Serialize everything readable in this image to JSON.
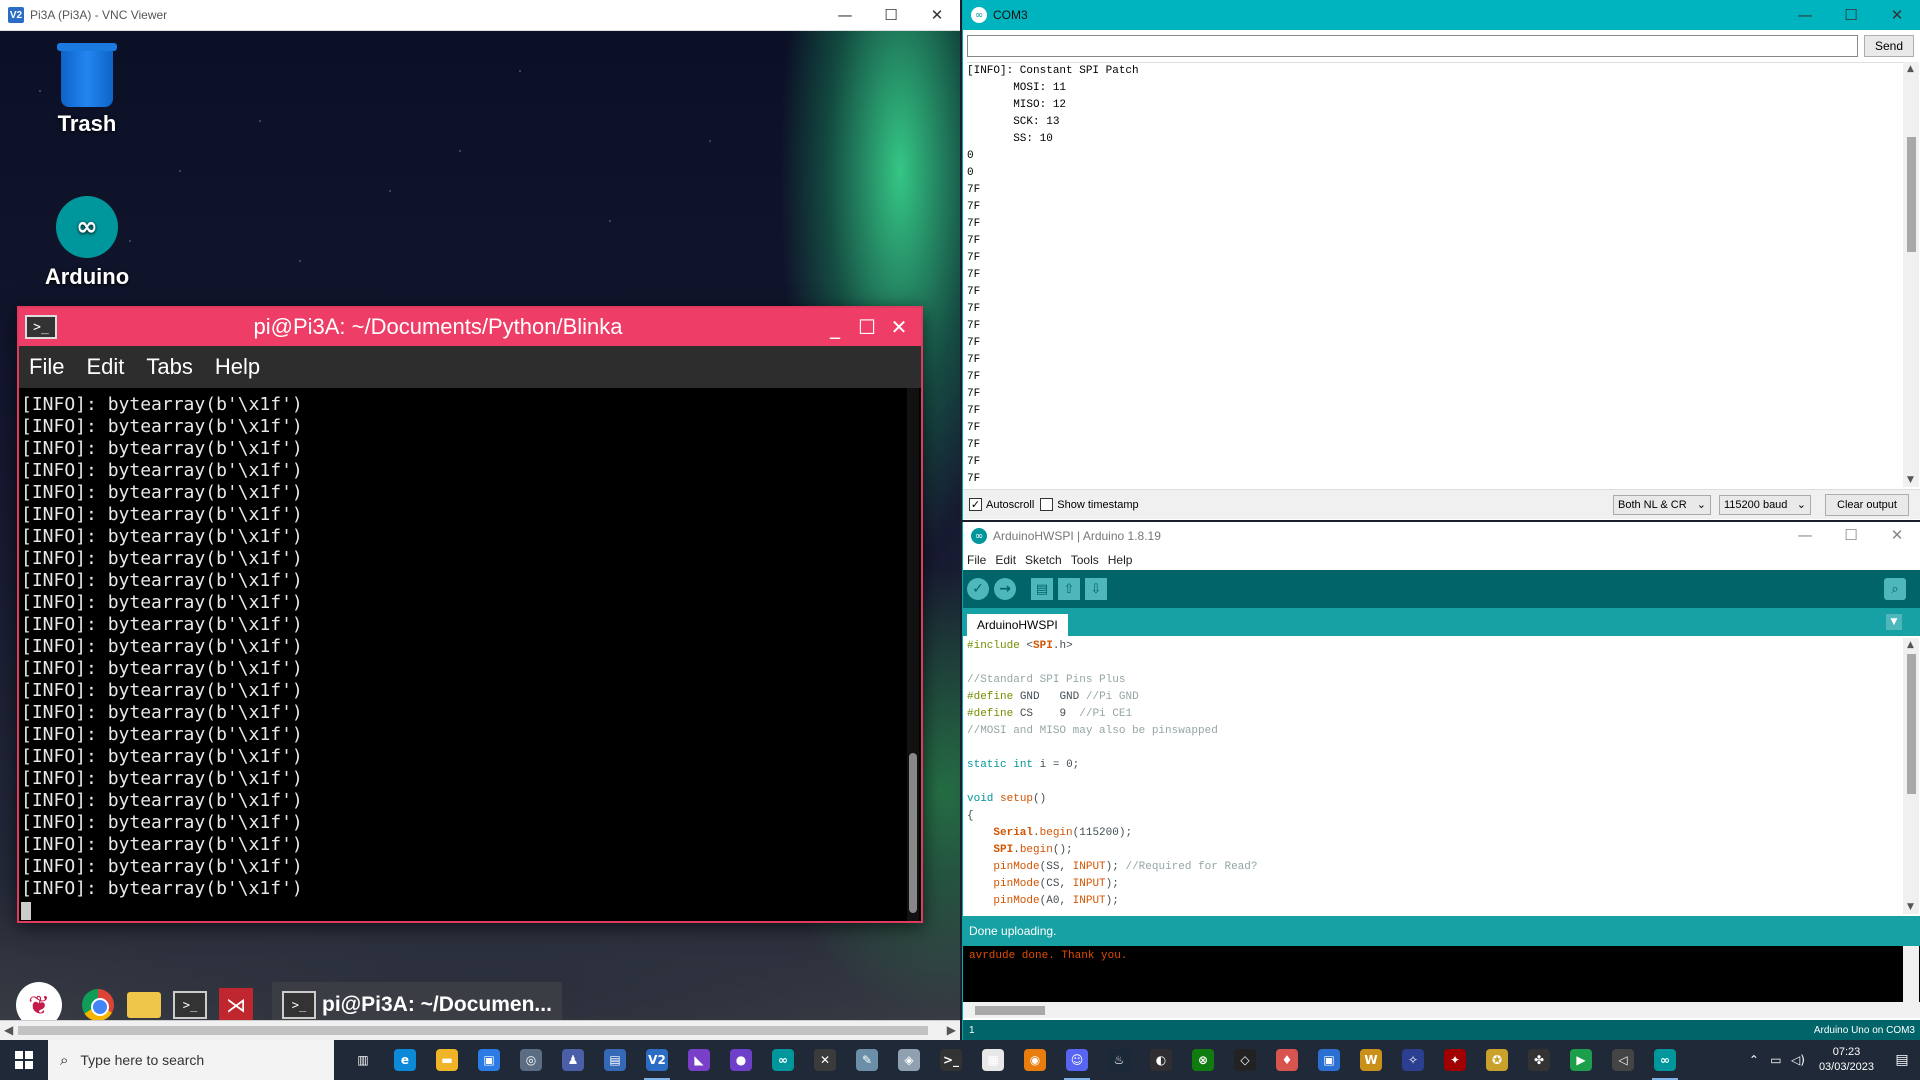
{
  "vnc": {
    "title": "Pi3A (Pi3A) - VNC Viewer",
    "app_badge": "V2",
    "controls": {
      "minimize": "—",
      "maximize": "☐",
      "close": "✕"
    },
    "desktop_icons": [
      {
        "label": "Trash",
        "icon": "trash-icon"
      },
      {
        "label": "Arduino",
        "icon": "arduino-icon"
      }
    ],
    "terminal": {
      "title": "pi@Pi3A: ~/Documents/Python/Blinka",
      "icon_glyph": ">_",
      "controls": {
        "minimize": "_",
        "maximize": "☐",
        "close": "✕"
      },
      "menu": [
        "File",
        "Edit",
        "Tabs",
        "Help"
      ],
      "lines": [
        "[INFO]: bytearray(b'\\x1f')",
        "[INFO]: bytearray(b'\\x1f')",
        "[INFO]: bytearray(b'\\x1f')",
        "[INFO]: bytearray(b'\\x1f')",
        "[INFO]: bytearray(b'\\x1f')",
        "[INFO]: bytearray(b'\\x1f')",
        "[INFO]: bytearray(b'\\x1f')",
        "[INFO]: bytearray(b'\\x1f')",
        "[INFO]: bytearray(b'\\x1f')",
        "[INFO]: bytearray(b'\\x1f')",
        "[INFO]: bytearray(b'\\x1f')",
        "[INFO]: bytearray(b'\\x1f')",
        "[INFO]: bytearray(b'\\x1f')",
        "[INFO]: bytearray(b'\\x1f')",
        "[INFO]: bytearray(b'\\x1f')",
        "[INFO]: bytearray(b'\\x1f')",
        "[INFO]: bytearray(b'\\x1f')",
        "[INFO]: bytearray(b'\\x1f')",
        "[INFO]: bytearray(b'\\x1f')",
        "[INFO]: bytearray(b'\\x1f')",
        "[INFO]: bytearray(b'\\x1f')",
        "[INFO]: bytearray(b'\\x1f')",
        "[INFO]: bytearray(b'\\x1f')"
      ]
    },
    "pi_taskbar": {
      "icons": [
        "raspberry-menu-icon",
        "chromium-icon",
        "file-manager-icon",
        "terminal-icon",
        "geany-icon"
      ],
      "task_label": "pi@Pi3A: ~/Documen...",
      "term_glyph": ">_"
    }
  },
  "serial": {
    "title": "COM3",
    "input_value": "",
    "send_label": "Send",
    "output": [
      "[INFO]: Constant SPI Patch",
      "       MOSI: 11",
      "       MISO: 12",
      "       SCK: 13",
      "       SS: 10",
      "0",
      "0",
      "7F",
      "7F",
      "7F",
      "7F",
      "7F",
      "7F",
      "7F",
      "7F",
      "7F",
      "7F",
      "7F",
      "7F",
      "7F",
      "7F",
      "7F",
      "7F",
      "7F",
      "7F"
    ],
    "autoscroll_label": "Autoscroll",
    "autoscroll_checked": true,
    "timestamp_label": "Show timestamp",
    "timestamp_checked": false,
    "line_ending": "Both NL & CR",
    "baud": "115200 baud",
    "clear_label": "Clear output"
  },
  "ide": {
    "title": "ArduinoHWSPI | Arduino 1.8.19",
    "menu": [
      "File",
      "Edit",
      "Sketch",
      "Tools",
      "Help"
    ],
    "tab": "ArduinoHWSPI",
    "code": [
      "#include <SPI.h>",
      "",
      "//Standard SPI Pins Plus",
      "#define GND   GND //Pi GND",
      "#define CS    9  //Pi CE1",
      "//MOSI and MISO may also be pinswapped",
      "",
      "static int i = 0;",
      "",
      "void setup()",
      "{",
      "    Serial.begin(115200);",
      "    SPI.begin();",
      "    pinMode(SS, INPUT); //Required for Read?",
      "    pinMode(CS, INPUT);",
      "    pinMode(A0, INPUT);"
    ],
    "status": "Done uploading.",
    "console": "avrdude done.  Thank you.",
    "line_number": "1",
    "board": "Arduino Uno on COM3"
  },
  "taskbar": {
    "search_placeholder": "Type here to search",
    "apps": [
      {
        "name": "task-view-icon",
        "color": "#1f2937",
        "glyph": "▥",
        "active": false
      },
      {
        "name": "edge-icon",
        "color": "#0c8ad8",
        "glyph": "e",
        "active": false
      },
      {
        "name": "file-explorer-icon",
        "color": "#f0b429",
        "glyph": "▬",
        "active": false
      },
      {
        "name": "store-icon",
        "color": "#2c7be5",
        "glyph": "▣",
        "active": false
      },
      {
        "name": "app-icon",
        "color": "#5a6d82",
        "glyph": "◎",
        "active": false
      },
      {
        "name": "app-icon",
        "color": "#4b5fa8",
        "glyph": "♟",
        "active": false
      },
      {
        "name": "app-icon",
        "color": "#3569b8",
        "glyph": "▤",
        "active": false
      },
      {
        "name": "vnc-viewer-icon",
        "color": "#2b6cc4",
        "glyph": "V2",
        "active": true
      },
      {
        "name": "visual-studio-icon",
        "color": "#7a3fc9",
        "glyph": "◣",
        "active": false
      },
      {
        "name": "github-desktop-icon",
        "color": "#6e40c9",
        "glyph": "●",
        "active": false
      },
      {
        "name": "arduino-icon",
        "color": "#00979c",
        "glyph": "∞",
        "active": false
      },
      {
        "name": "app-icon",
        "color": "#3b3b3b",
        "glyph": "✕",
        "active": false
      },
      {
        "name": "app-icon",
        "color": "#6b8fa8",
        "glyph": "✎",
        "active": false
      },
      {
        "name": "app-icon",
        "color": "#8fa0b0",
        "glyph": "◈",
        "active": false
      },
      {
        "name": "terminal-icon",
        "color": "#333333",
        "glyph": ">_",
        "active": false
      },
      {
        "name": "app-icon",
        "color": "#e8e8e8",
        "glyph": "▦",
        "active": false
      },
      {
        "name": "blender-icon",
        "color": "#e87d0d",
        "glyph": "◉",
        "active": false
      },
      {
        "name": "discord-icon",
        "color": "#5865f2",
        "glyph": "☺",
        "active": true
      },
      {
        "name": "steam-icon",
        "color": "#1b2838",
        "glyph": "♨",
        "active": false
      },
      {
        "name": "obs-icon",
        "color": "#302e31",
        "glyph": "◐",
        "active": false
      },
      {
        "name": "xbox-icon",
        "color": "#107c10",
        "glyph": "⊗",
        "active": false
      },
      {
        "name": "unity-icon",
        "color": "#222222",
        "glyph": "◇",
        "active": false
      },
      {
        "name": "app-icon",
        "color": "#d9534f",
        "glyph": "♦",
        "active": false
      },
      {
        "name": "app-icon",
        "color": "#2a6fd1",
        "glyph": "▣",
        "active": false
      },
      {
        "name": "warcraft-icon",
        "color": "#c9901a",
        "glyph": "W",
        "active": false
      },
      {
        "name": "app-icon",
        "color": "#2c3e8f",
        "glyph": "✧",
        "active": false
      },
      {
        "name": "app-icon",
        "color": "#a00000",
        "glyph": "✦",
        "active": false
      },
      {
        "name": "app-icon",
        "color": "#caa12a",
        "glyph": "✪",
        "active": false
      },
      {
        "name": "app-icon",
        "color": "#333333",
        "glyph": "✤",
        "active": false
      },
      {
        "name": "app-icon",
        "color": "#1d9e4a",
        "glyph": "▶",
        "active": false
      },
      {
        "name": "unity-hub-icon",
        "color": "#444444",
        "glyph": "◁",
        "active": false
      },
      {
        "name": "arduino-icon",
        "color": "#00979c",
        "glyph": "∞",
        "active": true
      }
    ],
    "tray": [
      "chevron-up-icon",
      "network-icon",
      "volume-icon"
    ],
    "time": "07:23",
    "date": "03/03/2023"
  }
}
